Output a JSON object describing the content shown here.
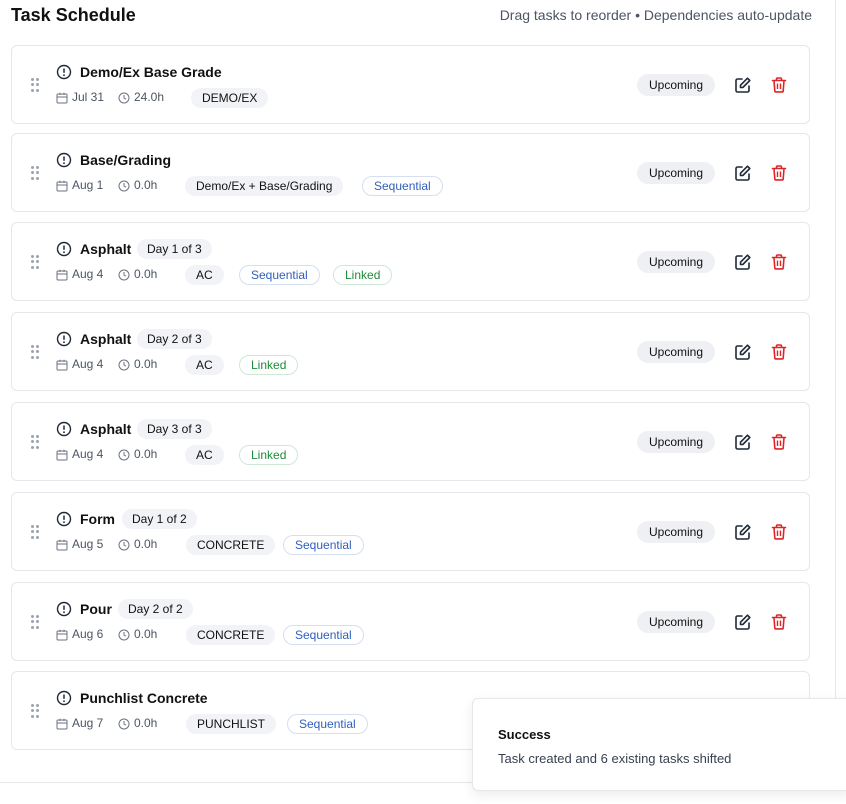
{
  "header": {
    "title": "Task Schedule",
    "hint": "Drag tasks to reorder • Dependencies auto-update"
  },
  "icons": {
    "grip": "grip-vertical-icon",
    "alert": "alert-circle-icon",
    "date": "calendar-icon",
    "hours": "clock-icon",
    "edit": "edit-icon",
    "delete": "trash-icon"
  },
  "colors": {
    "sequential": "#2f5fbd",
    "linked": "#1f8a3a",
    "delete": "#dc2626"
  },
  "tasks": [
    {
      "name": "Demo/Ex Base Grade",
      "date": "Jul 31",
      "hours": "24.0h",
      "tag": "DEMO/EX",
      "status": "Upcoming"
    },
    {
      "name": "Base/Grading",
      "date": "Aug 1",
      "hours": "0.0h",
      "tag": "Demo/Ex + Base/Grading",
      "sequential": "Sequential",
      "status": "Upcoming"
    },
    {
      "name": "Asphalt",
      "day": "Day 1 of 3",
      "date": "Aug 4",
      "hours": "0.0h",
      "tag": "AC",
      "sequential": "Sequential",
      "linked": "Linked",
      "status": "Upcoming"
    },
    {
      "name": "Asphalt",
      "day": "Day 2 of 3",
      "date": "Aug 4",
      "hours": "0.0h",
      "tag": "AC",
      "linked": "Linked",
      "status": "Upcoming"
    },
    {
      "name": "Asphalt",
      "day": "Day 3 of 3",
      "date": "Aug 4",
      "hours": "0.0h",
      "tag": "AC",
      "linked": "Linked",
      "status": "Upcoming"
    },
    {
      "name": "Form",
      "day": "Day 1 of 2",
      "date": "Aug 5",
      "hours": "0.0h",
      "tag": "CONCRETE",
      "sequential": "Sequential",
      "status": "Upcoming"
    },
    {
      "name": "Pour",
      "day": "Day 2 of 2",
      "date": "Aug 6",
      "hours": "0.0h",
      "tag": "CONCRETE",
      "sequential": "Sequential",
      "status": "Upcoming"
    },
    {
      "name": "Punchlist Concrete",
      "date": "Aug 7",
      "hours": "0.0h",
      "tag": "PUNCHLIST",
      "sequential": "Sequential"
    }
  ],
  "toast": {
    "title": "Success",
    "message": "Task created and 6 existing tasks shifted"
  }
}
